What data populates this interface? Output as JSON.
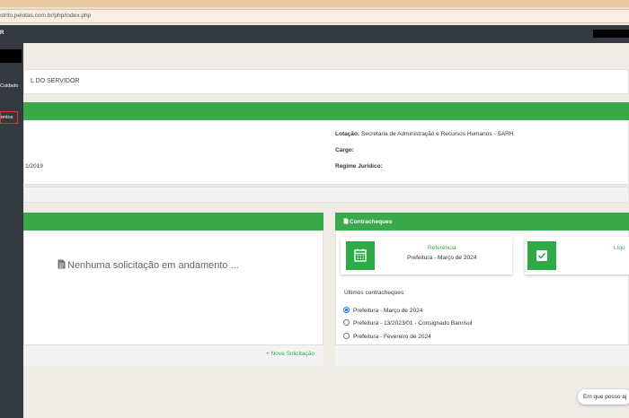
{
  "browser": {
    "url": "strito.pelotas.com.br/php/index.php"
  },
  "topbar": {
    "title": "R"
  },
  "sidebar": {
    "items": [
      {
        "label": "Cuidado"
      },
      {
        "label": "entos"
      }
    ]
  },
  "breadcrumb": {
    "text": "L DO SERVIDOR"
  },
  "info": {
    "date_value": "1/2019",
    "lotacao_label": "Lotação:",
    "lotacao_value": "Secretaria de Administração e Recursos Humanos - SARH",
    "cargo_label": "Cargo:",
    "regime_label": "Regime Jurídico:"
  },
  "solicitacoes": {
    "empty_text": "Nenhuma solicitação em andamento ...",
    "new_link": "+ Nova Solicitação"
  },
  "contracheques": {
    "title": "Contracheques",
    "referencia_label": "Referência",
    "referencia_value": "Prefeitura - Março de 2024",
    "liquido_label": "Líqu",
    "ultimos_label": "Últimos contracheques:",
    "options": [
      {
        "label": "Prefeitura - Março de 2024",
        "selected": true
      },
      {
        "label": "Prefeitura - 13/2023/01 - Consignado Banrisul",
        "selected": false
      },
      {
        "label": "Prefeitura - Fevereiro de 2024",
        "selected": false
      }
    ]
  },
  "chat": {
    "text": "Em que posso aj"
  },
  "colors": {
    "accent": "#3aa94a",
    "sidebar": "#343a40",
    "annotation": "#e53030"
  }
}
